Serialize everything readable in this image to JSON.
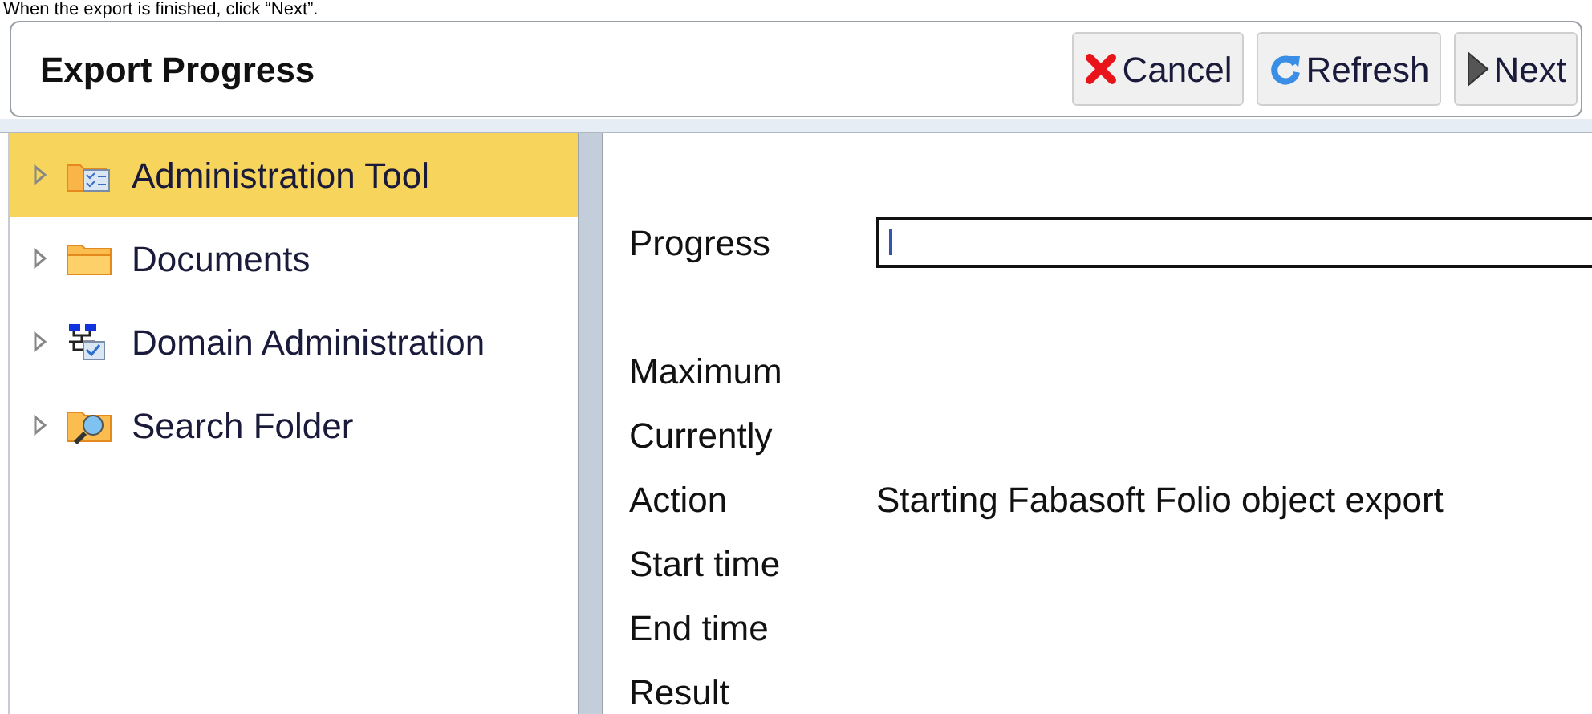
{
  "instruction": "When the export is finished, click “Next”.",
  "header": {
    "title": "Export Progress",
    "buttons": [
      {
        "kind": "cancel",
        "label": "Cancel"
      },
      {
        "kind": "refresh",
        "label": "Refresh"
      },
      {
        "kind": "next",
        "label": "Next"
      }
    ]
  },
  "tree": {
    "items": [
      {
        "label": "Administration Tool",
        "kind": "admin",
        "selected": true,
        "expanded": false
      },
      {
        "label": "Documents",
        "kind": "folder",
        "selected": false,
        "expanded": false
      },
      {
        "label": "Domain Administration",
        "kind": "domain",
        "selected": false,
        "expanded": false
      },
      {
        "label": "Search Folder",
        "kind": "search",
        "selected": false,
        "expanded": false
      }
    ]
  },
  "form": {
    "progress": {
      "label": "Progress",
      "level": 0
    },
    "fields": [
      {
        "label": "Maximum"
      },
      {
        "label": "Currently"
      },
      {
        "label": "Action",
        "value": "Starting Fabasoft Folio object export"
      },
      {
        "label": "Start time"
      },
      {
        "label": "End time"
      },
      {
        "label": "Result"
      }
    ]
  }
}
